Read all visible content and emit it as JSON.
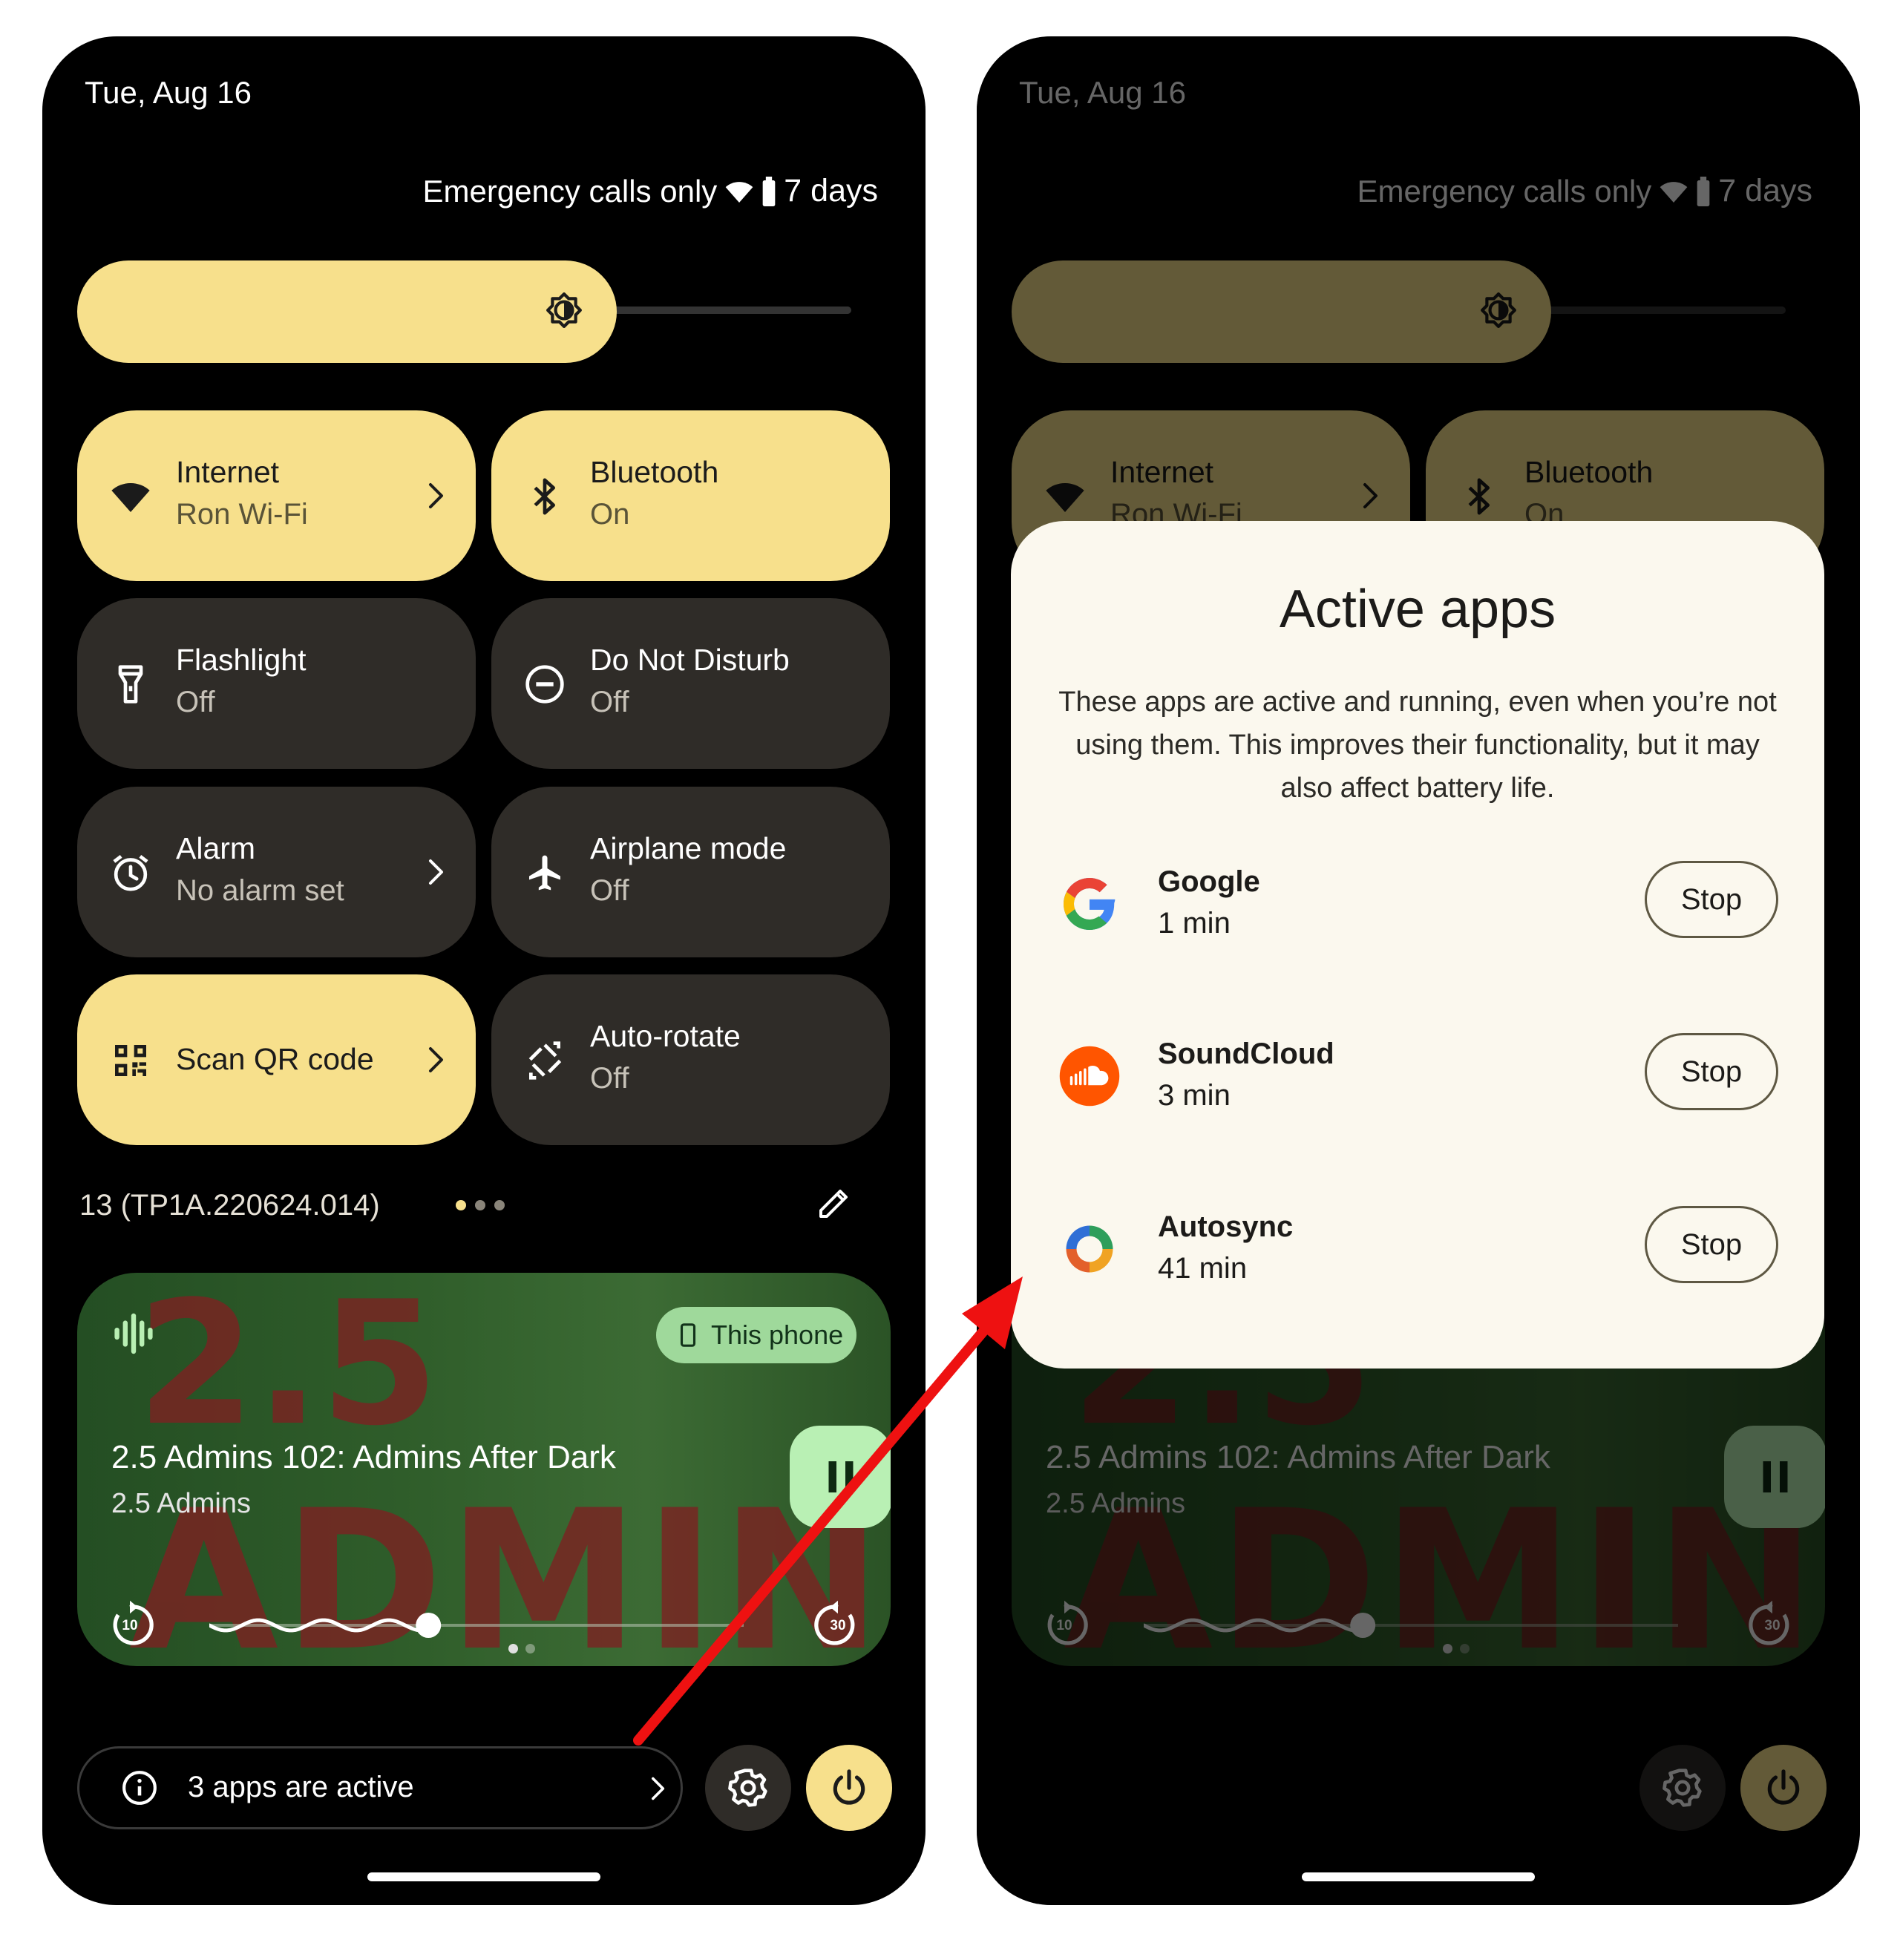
{
  "status_bar": {
    "date": "Tue, Aug 16",
    "network": "Emergency calls only",
    "battery": "7 days"
  },
  "tiles": [
    {
      "title": "Internet",
      "subtitle": "Ron Wi-Fi",
      "icon": "wifi-icon",
      "state": "on"
    },
    {
      "title": "Bluetooth",
      "subtitle": "On",
      "icon": "bluetooth-icon",
      "state": "on"
    },
    {
      "title": "Flashlight",
      "subtitle": "Off",
      "icon": "flashlight-icon",
      "state": "off"
    },
    {
      "title": "Do Not Disturb",
      "subtitle": "Off",
      "icon": "do-not-disturb-icon",
      "state": "off"
    },
    {
      "title": "Alarm",
      "subtitle": "No alarm set",
      "icon": "alarm-icon",
      "state": "off"
    },
    {
      "title": "Airplane mode",
      "subtitle": "Off",
      "icon": "airplane-icon",
      "state": "off"
    },
    {
      "title": "Scan QR code",
      "icon": "qr-code-icon",
      "state": "on"
    },
    {
      "title": "Auto-rotate",
      "subtitle": "Off",
      "icon": "auto-rotate-icon",
      "state": "off"
    }
  ],
  "build_number": "13 (TP1A.220624.014)",
  "media": {
    "output_chip": "This phone",
    "title": "2.5 Admins 102: Admins After Dark",
    "artist": "2.5 Admins",
    "artwork_text_top": "2.5",
    "artwork_text_bottom": "ADMINS",
    "skip_back_seconds": "10",
    "skip_forward_seconds": "30",
    "progress": 0.41
  },
  "footer": {
    "active_apps_label": "3 apps are active"
  },
  "dialog": {
    "title": "Active apps",
    "description": "These apps are active and running, even when you’re not using them. This improves their functionality, but it may also affect battery life.",
    "apps": [
      {
        "name": "Google",
        "time": "1 min",
        "stop_label": "Stop",
        "icon": "google-icon"
      },
      {
        "name": "SoundCloud",
        "time": "3 min",
        "stop_label": "Stop",
        "icon": "soundcloud-icon"
      },
      {
        "name": "Autosync",
        "time": "41 min",
        "stop_label": "Stop",
        "icon": "autosync-icon"
      }
    ]
  },
  "colors": {
    "accent": "#f7e08c",
    "tile_off": "#2f2c28",
    "media_chip": "#9fd99b",
    "dialog_bg": "#fbf8ee",
    "annotation_arrow": "#ee1111"
  }
}
